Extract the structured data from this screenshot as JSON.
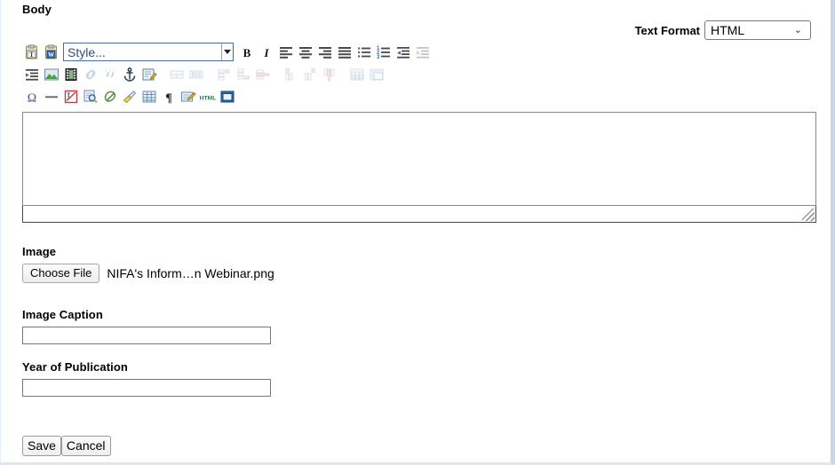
{
  "body_section": {
    "label": "Body",
    "text_format_label": "Text Format",
    "text_format_value": "HTML",
    "text_format_options": [
      "HTML"
    ]
  },
  "editor": {
    "style_combo_placeholder": "Style...",
    "content": "",
    "toolbar_rows": [
      [
        {
          "name": "paste-text-icon",
          "title": "Paste as plain text",
          "enabled": true
        },
        {
          "name": "paste-from-word-icon",
          "title": "Paste from Word",
          "enabled": true
        },
        {
          "name": "style-combo",
          "title": "Style...",
          "enabled": true
        },
        {
          "name": "bold-icon",
          "title": "Bold",
          "enabled": true
        },
        {
          "name": "italic-icon",
          "title": "Italic",
          "enabled": true
        },
        {
          "name": "align-left-icon",
          "title": "Align Left",
          "enabled": true
        },
        {
          "name": "align-center-icon",
          "title": "Center",
          "enabled": true
        },
        {
          "name": "align-right-icon",
          "title": "Align Right",
          "enabled": true
        },
        {
          "name": "align-justify-icon",
          "title": "Justify",
          "enabled": true
        },
        {
          "name": "bulleted-list-icon",
          "title": "Insert/Remove Bulleted List",
          "enabled": true
        },
        {
          "name": "numbered-list-icon",
          "title": "Insert/Remove Numbered List",
          "enabled": true
        },
        {
          "name": "outdent-icon",
          "title": "Decrease Indent",
          "enabled": true
        },
        {
          "name": "indent-icon",
          "title": "Increase Indent",
          "enabled": false
        }
      ],
      [
        {
          "name": "blockquote-indent-icon",
          "title": "Block Quote",
          "enabled": true
        },
        {
          "name": "image-icon",
          "title": "Image",
          "enabled": true
        },
        {
          "name": "media-icon",
          "title": "Flash / Media",
          "enabled": true
        },
        {
          "name": "link-icon",
          "title": "Link",
          "enabled": false
        },
        {
          "name": "unlink-icon",
          "title": "Unlink",
          "enabled": false
        },
        {
          "name": "anchor-icon",
          "title": "Anchor",
          "enabled": true
        },
        {
          "name": "edit-form-icon",
          "title": "Edit",
          "enabled": true
        },
        {
          "name": "merge-cells-icon",
          "title": "Merge Cells",
          "enabled": false
        },
        {
          "name": "split-cell-icon",
          "title": "Split Cell",
          "enabled": false
        },
        {
          "name": "insert-row-before-icon",
          "title": "Insert Row Before",
          "enabled": false
        },
        {
          "name": "insert-row-after-icon",
          "title": "Insert Row After",
          "enabled": false
        },
        {
          "name": "delete-row-icon",
          "title": "Delete Rows",
          "enabled": false
        },
        {
          "name": "insert-column-before-icon",
          "title": "Insert Column Before",
          "enabled": false
        },
        {
          "name": "insert-column-after-icon",
          "title": "Insert Column After",
          "enabled": false
        },
        {
          "name": "delete-column-icon",
          "title": "Delete Columns",
          "enabled": false
        },
        {
          "name": "table-icon",
          "title": "Table",
          "enabled": false
        },
        {
          "name": "table-properties-icon",
          "title": "Table Properties",
          "enabled": false
        }
      ],
      [
        {
          "name": "special-character-icon",
          "title": "Insert Special Character",
          "enabled": true
        },
        {
          "name": "horizontal-rule-icon",
          "title": "Insert Horizontal Line",
          "enabled": true
        },
        {
          "name": "remove-format-icon",
          "title": "Remove Format",
          "enabled": true
        },
        {
          "name": "find-icon",
          "title": "Find",
          "enabled": true
        },
        {
          "name": "eraser-icon",
          "title": "Clear",
          "enabled": true
        },
        {
          "name": "paint-format-icon",
          "title": "Copy Formatting",
          "enabled": true
        },
        {
          "name": "show-blocks-icon",
          "title": "Show Blocks",
          "enabled": true
        },
        {
          "name": "paragraph-icon",
          "title": "Paragraph",
          "enabled": true
        },
        {
          "name": "templates-icon",
          "title": "Templates",
          "enabled": true
        },
        {
          "name": "source-html-icon",
          "title": "Source",
          "enabled": true
        },
        {
          "name": "maximize-icon",
          "title": "Maximize",
          "enabled": true
        }
      ]
    ]
  },
  "image_section": {
    "label": "Image",
    "choose_file_label": "Choose File",
    "file_name": "NIFA's Inform…n Webinar.png"
  },
  "caption_section": {
    "label": "Image Caption",
    "value": "",
    "placeholder": ""
  },
  "year_section": {
    "label": "Year of Publication",
    "value": "",
    "placeholder": ""
  },
  "actions": {
    "save_label": "Save",
    "cancel_label": "Cancel"
  },
  "colors": {
    "accent_blue": "#2b4f86",
    "border_gray": "#888a8c",
    "page_edge": "#c9d6e8"
  }
}
